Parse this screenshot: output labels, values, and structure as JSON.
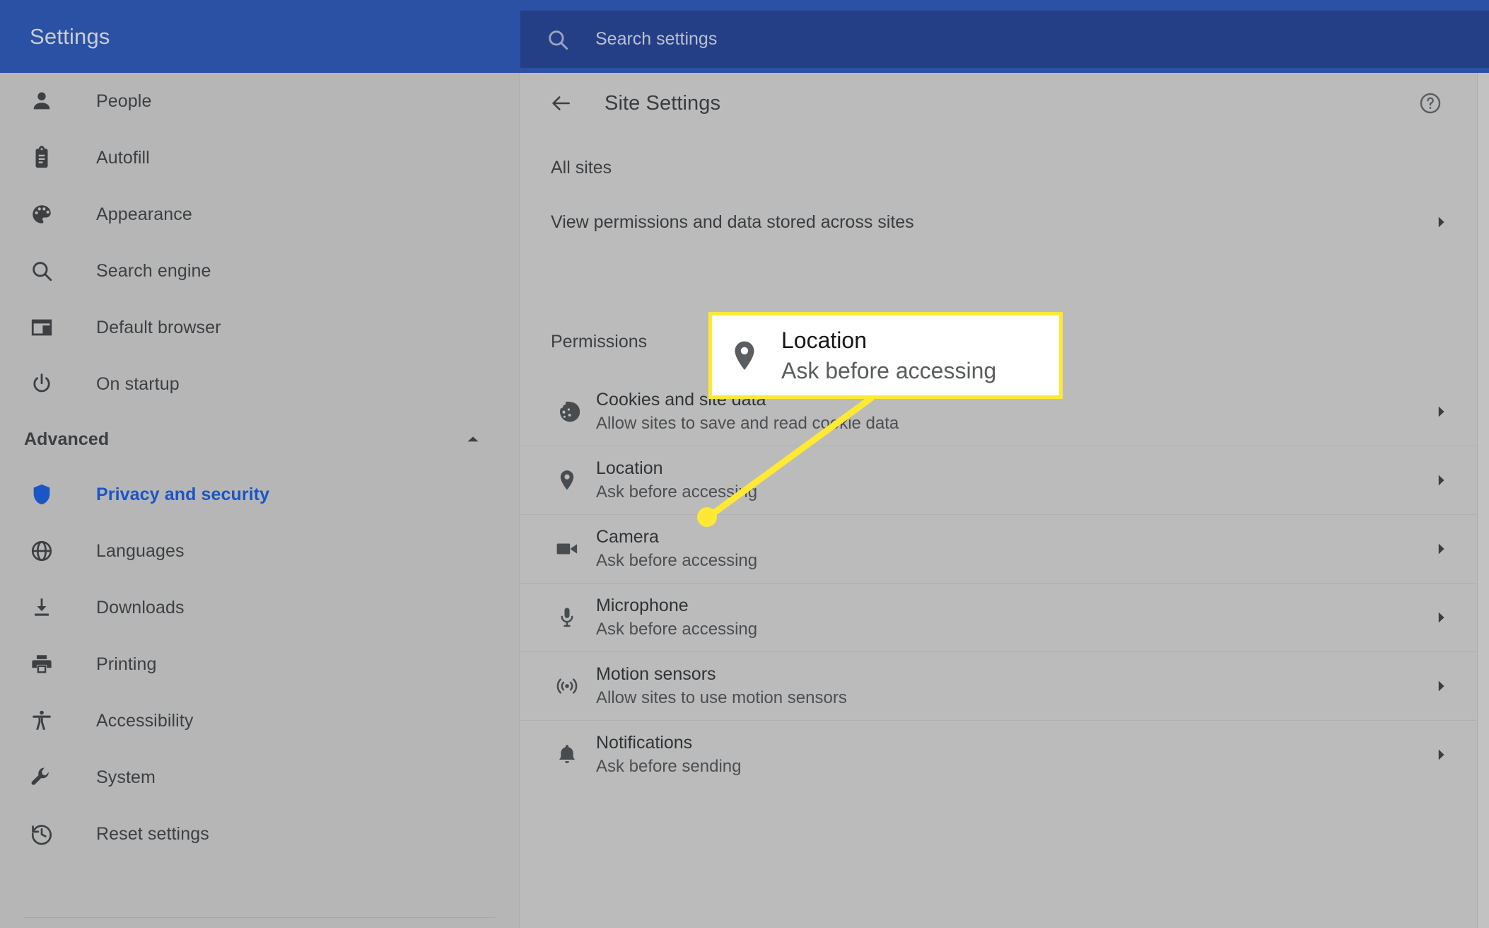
{
  "app": {
    "brand_title": "Settings",
    "accent_blue": "#2a51a3",
    "search_field_bg": "#253f86",
    "highlight_yellow": "#ffe933",
    "link_blue": "#1a56c4"
  },
  "search": {
    "placeholder": "Search settings",
    "value": "",
    "icon": "search-icon"
  },
  "sidebar": {
    "items": [
      {
        "label": "People",
        "icon": "person-icon",
        "active": false
      },
      {
        "label": "Autofill",
        "icon": "clipboard-icon",
        "active": false
      },
      {
        "label": "Appearance",
        "icon": "palette-icon",
        "active": false
      },
      {
        "label": "Search engine",
        "icon": "search-icon",
        "active": false
      },
      {
        "label": "Default browser",
        "icon": "browser-window-icon",
        "active": false
      },
      {
        "label": "On startup",
        "icon": "power-icon",
        "active": false
      }
    ],
    "advanced": {
      "label": "Advanced",
      "icon": "chevron-up-icon",
      "expanded": true
    },
    "advanced_items": [
      {
        "label": "Privacy and security",
        "icon": "shield-icon",
        "active": true
      },
      {
        "label": "Languages",
        "icon": "globe-icon",
        "active": false
      },
      {
        "label": "Downloads",
        "icon": "download-icon",
        "active": false
      },
      {
        "label": "Printing",
        "icon": "printer-icon",
        "active": false
      },
      {
        "label": "Accessibility",
        "icon": "accessibility-icon",
        "active": false
      },
      {
        "label": "System",
        "icon": "wrench-icon",
        "active": false
      },
      {
        "label": "Reset settings",
        "icon": "history-icon",
        "active": false
      }
    ]
  },
  "main": {
    "back_icon": "arrow-left-icon",
    "title": "Site Settings",
    "help_icon": "help-circle-icon",
    "all_sites_label": "All sites",
    "view_permissions_row": {
      "label": "View permissions and data stored across sites",
      "chevron": "chevron-right-icon"
    },
    "permissions_label": "Permissions",
    "permissions": [
      {
        "title": "Cookies and site data",
        "sub": "Allow sites to save and read cookie data",
        "icon": "cookie-icon",
        "chevron": "chevron-right-icon"
      },
      {
        "title": "Location",
        "sub": "Ask before accessing",
        "icon": "location-pin-icon",
        "chevron": "chevron-right-icon"
      },
      {
        "title": "Camera",
        "sub": "Ask before accessing",
        "icon": "camera-icon",
        "chevron": "chevron-right-icon"
      },
      {
        "title": "Microphone",
        "sub": "Ask before accessing",
        "icon": "microphone-icon",
        "chevron": "chevron-right-icon"
      },
      {
        "title": "Motion sensors",
        "sub": "Allow sites to use motion sensors",
        "icon": "motion-sensor-icon",
        "chevron": "chevron-right-icon"
      },
      {
        "title": "Notifications",
        "sub": "Ask before sending",
        "icon": "bell-icon",
        "chevron": "chevron-right-icon"
      }
    ]
  },
  "annotation": {
    "callout": {
      "title": "Location",
      "sub": "Ask before accessing",
      "icon": "location-pin-icon"
    }
  }
}
